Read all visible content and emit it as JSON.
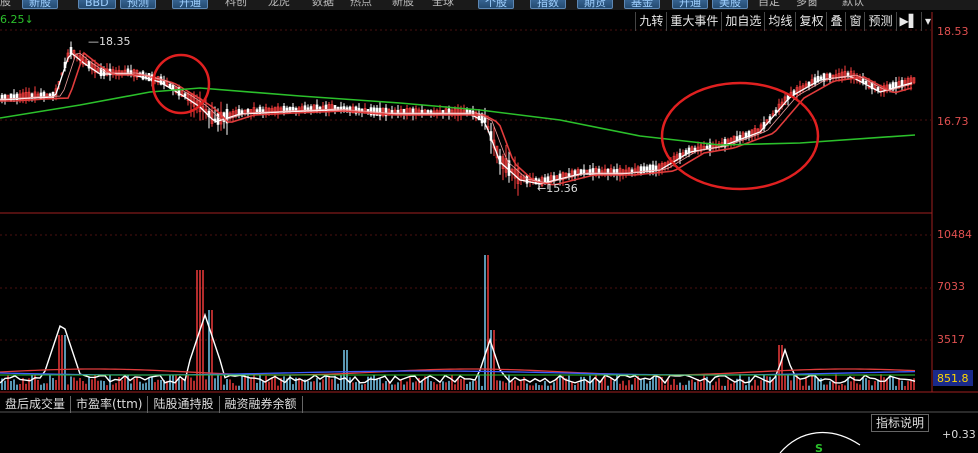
{
  "top_tabs": [
    {
      "label": "股",
      "type": "text"
    },
    {
      "label": "新股",
      "type": "btn"
    },
    {
      "label": "BBD",
      "type": "btn"
    },
    {
      "label": "预测",
      "type": "btn"
    },
    {
      "label": "开通",
      "type": "btn"
    },
    {
      "label": "科创",
      "type": "text"
    },
    {
      "label": "龙虎",
      "type": "text"
    },
    {
      "label": "数据",
      "type": "text"
    },
    {
      "label": "热点",
      "type": "text"
    },
    {
      "label": "新股",
      "type": "text"
    },
    {
      "label": "全球",
      "type": "text"
    },
    {
      "label": "个股",
      "type": "btn"
    },
    {
      "label": "指数",
      "type": "btn"
    },
    {
      "label": "期货",
      "type": "btn"
    },
    {
      "label": "基金",
      "type": "btn"
    },
    {
      "label": "开通",
      "type": "btn"
    },
    {
      "label": "美股",
      "type": "btn"
    },
    {
      "label": "自定",
      "type": "text"
    },
    {
      "label": "多窗",
      "type": "text"
    },
    {
      "label": "默认",
      "type": "text"
    }
  ],
  "toolbar": [
    "九转",
    "重大事件",
    "加自选",
    "均线",
    "复权",
    "叠",
    "窗",
    "预测"
  ],
  "price_axis": {
    "top": "18.53",
    "mid": "16.73",
    "current_left": "6.25"
  },
  "volume_axis": {
    "labels": [
      "10484",
      "7033",
      "3517"
    ],
    "current": "851.8"
  },
  "annotations": {
    "high": "18.35",
    "low": "15.36",
    "lower_right": "+0.33"
  },
  "indicator_tabs": [
    "盘后成交量",
    "市盈率(ttm)",
    "陆股通持股",
    "融资融券余额"
  ],
  "help_label": "指标说明",
  "colors": {
    "ma_red": "#e03c3c",
    "ma_green": "#2bc02b",
    "candle": "#ffffff",
    "up": "#ff4040",
    "vol_blue": "#3b5bff",
    "circle": "#e02020",
    "axis_text": "#e05050"
  }
}
